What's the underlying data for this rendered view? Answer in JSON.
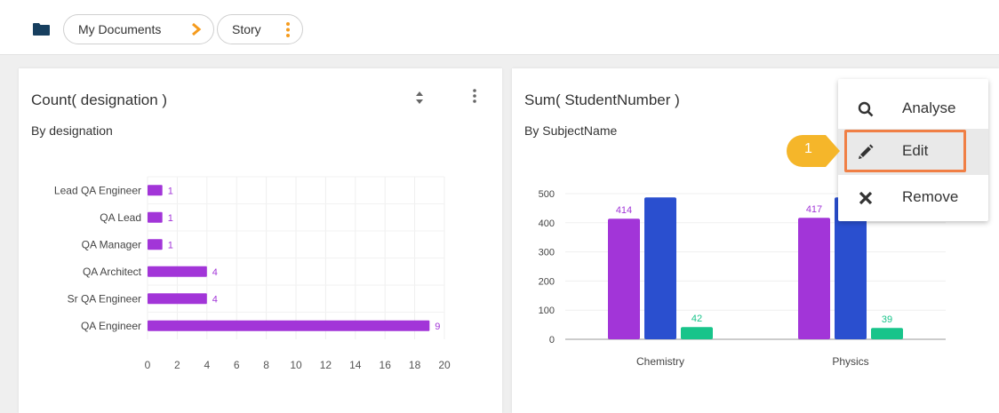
{
  "breadcrumb": {
    "folder_icon": "folder-icon",
    "items": [
      {
        "label": "My Documents",
        "icon": "chevron-right-icon"
      },
      {
        "label": "Story",
        "icon": "kebab-icon"
      }
    ]
  },
  "colors": {
    "accent_orange": "#f59b1d",
    "purple": "#a235d8",
    "blue": "#2a4fcf",
    "green": "#18c48a",
    "highlight": "#f07f45"
  },
  "cards": [
    {
      "title": "Count( designation )",
      "subtitle": "By designation",
      "icons": [
        "sort-icon",
        "kebab-icon"
      ],
      "chart_data": {
        "type": "bar",
        "orientation": "horizontal",
        "title": "Count( designation )",
        "subtitle": "By designation",
        "categories": [
          "Lead QA Engineer",
          "QA Lead",
          "QA Manager",
          "QA Architect",
          "Sr QA Engineer",
          "QA Engineer"
        ],
        "values": [
          1,
          1,
          1,
          4,
          4,
          19
        ],
        "data_labels": [
          "1",
          "1",
          "1",
          "4",
          "4",
          "9"
        ],
        "xlim": [
          0,
          20
        ],
        "xticks": [
          "0",
          "2",
          "4",
          "6",
          "8",
          "10",
          "12",
          "14",
          "16",
          "18",
          "20"
        ],
        "grid": true,
        "color": "#a235d8"
      }
    },
    {
      "title": "Sum( StudentNumber )",
      "subtitle": "By SubjectName",
      "chart_data": {
        "type": "bar",
        "title": "Sum( StudentNumber )",
        "subtitle": "By SubjectName",
        "categories": [
          "Chemistry",
          "Physics"
        ],
        "series": [
          {
            "values": [
              414,
              417
            ],
            "color": "#a235d8",
            "labels": [
              "414",
              "417"
            ]
          },
          {
            "values": [
              487,
              487
            ],
            "color": "#2a4fcf",
            "labels": [
              "",
              ""
            ]
          },
          {
            "values": [
              42,
              39
            ],
            "color": "#18c48a",
            "labels": [
              "42",
              "39"
            ]
          }
        ],
        "ylim": [
          0,
          500
        ],
        "yticks": [
          "0",
          "100",
          "200",
          "300",
          "400",
          "500"
        ],
        "grid": true
      }
    }
  ],
  "context_menu": {
    "items": [
      {
        "label": "Analyse",
        "icon": "search-icon"
      },
      {
        "label": "Edit",
        "icon": "pencil-icon"
      },
      {
        "label": "Remove",
        "icon": "close-icon"
      }
    ]
  },
  "step_badge": "1"
}
